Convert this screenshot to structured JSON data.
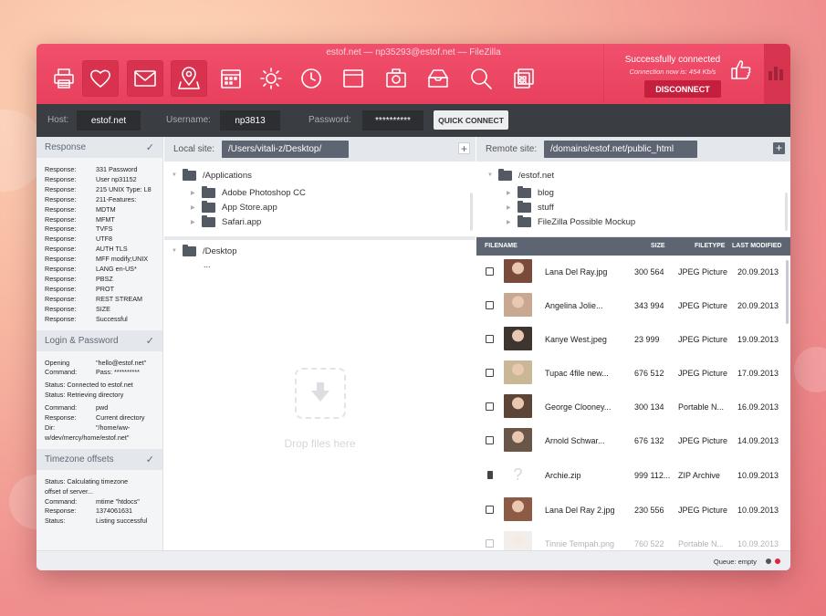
{
  "window": {
    "title": "estof.net — np35293@estof.net — FileZilla"
  },
  "toolbar": {
    "icons": [
      "printer-icon",
      "heart-icon",
      "mail-icon",
      "map-pin-icon",
      "calendar-icon",
      "sun-icon",
      "clock-icon",
      "window-icon",
      "camera-icon",
      "inbox-icon",
      "search-icon",
      "layers-icon"
    ]
  },
  "connection": {
    "status": "Successfully connected",
    "rate_label": "Connection now is: 454 Kb/s",
    "disconnect_label": "DISCONNECT",
    "thumb_icon": "thumbs-up-icon",
    "stats_icon": "bar-chart-icon"
  },
  "connect_bar": {
    "host_label": "Host:",
    "host_value": "estof.net",
    "username_label": "Username:",
    "username_value": "np3813",
    "password_label": "Password:",
    "password_value": "**********",
    "quick_connect_label": "QUICK CONNECT"
  },
  "log": {
    "response": {
      "title": "Response",
      "rows": [
        {
          "k": "Response:",
          "v": "331 Password"
        },
        {
          "k": "Response:",
          "v": "User np31152"
        },
        {
          "k": "Response:",
          "v": "215 UNIX Type: L8"
        },
        {
          "k": "Response:",
          "v": "211-Features:"
        },
        {
          "k": "Response:",
          "v": "MDTM"
        },
        {
          "k": "Response:",
          "v": "MFMT"
        },
        {
          "k": "Response:",
          "v": "TVFS"
        },
        {
          "k": "Response:",
          "v": "UTF8"
        },
        {
          "k": "Response:",
          "v": "AUTH TLS"
        },
        {
          "k": "Response:",
          "v": "MFF modify;UNIX"
        },
        {
          "k": "Response:",
          "v": "LANG en-US*"
        },
        {
          "k": "Response:",
          "v": "PBSZ"
        },
        {
          "k": "Response:",
          "v": "PROT"
        },
        {
          "k": "Response:",
          "v": "REST STREAM"
        },
        {
          "k": "Response:",
          "v": "SIZE"
        },
        {
          "k": "Response:",
          "v": "Successful"
        }
      ]
    },
    "login": {
      "title": "Login & Password",
      "l1k": "Opening",
      "l1v": "\"hello@estof.net\"",
      "l2k": "Command:",
      "l2v": "Pass: **********",
      "l3": "Status: Connected to estof.net",
      "l4": "Status: Retrieving directory",
      "l5k": "Command:",
      "l5v": "pwd",
      "l6k": "Response:",
      "l6v": "Current directory",
      "l7k": "Dir:",
      "l7v": "\"/home/ww-",
      "l8": "w/dev/mercy/home/estof.net\""
    },
    "timezone": {
      "title": "Timezone offsets",
      "l1": "Status: Calculating timezone",
      "l2": "offset of server...",
      "l3k": "Command:",
      "l3v": "mtime \"htdocs\"",
      "l4k": "Response:",
      "l4v": "1374061631",
      "l5k": "Status:",
      "l5v": "Listing successful"
    }
  },
  "local": {
    "label": "Local site:",
    "path": "/Users/vitali-z/Desktop/",
    "tree": {
      "root": "/Applications",
      "children": [
        "Adobe Photoshop CC",
        "App Store.app",
        "Safari.app"
      ]
    },
    "desktop": {
      "root": "/Desktop",
      "child": "..."
    },
    "drop_text": "Drop files here"
  },
  "remote": {
    "label": "Remote site:",
    "path": "/domains/estof.net/public_html",
    "tree": {
      "root": "/estof.net",
      "children": [
        "blog",
        "stuff",
        "FileZilla Possible Mockup"
      ]
    },
    "headers": {
      "filename": "FILENAME",
      "size": "SIZE",
      "filetype": "FILETYPE",
      "modified": "LAST MODIFIED"
    },
    "files": [
      {
        "name": "Lana Del Ray.jpg",
        "size": "300 564",
        "type": "JPEG Picture",
        "date": "20.09.2013"
      },
      {
        "name": "Angelina Jolie...",
        "size": "343 994",
        "type": "JPEG Picture",
        "date": "20.09.2013"
      },
      {
        "name": "Kanye West.jpeg",
        "size": "23 999",
        "type": "JPEG Picture",
        "date": "19.09.2013"
      },
      {
        "name": "Tupac 4file new...",
        "size": "676 512",
        "type": "JPEG Picture",
        "date": "17.09.2013"
      },
      {
        "name": "George Clooney...",
        "size": "300 134",
        "type": "Portable N...",
        "date": "16.09.2013"
      },
      {
        "name": "Arnold Schwar...",
        "size": "676 132",
        "type": "JPEG Picture",
        "date": "14.09.2013"
      },
      {
        "name": "Archie.zip",
        "size": "999 112...",
        "type": "ZIP Archive",
        "date": "10.09.2013"
      },
      {
        "name": "Lana Del Ray 2.jpg",
        "size": "230 556",
        "type": "JPEG Picture",
        "date": "10.09.2013"
      },
      {
        "name": "Tinnie Tempah.png",
        "size": "760 522",
        "type": "Portable N...",
        "date": "10.09.2013"
      }
    ]
  },
  "status_bar": {
    "queue": "Queue: empty"
  },
  "colors": {
    "brand": "#e8405d",
    "dark": "#3a3d42",
    "path_box": "#5e6572"
  }
}
